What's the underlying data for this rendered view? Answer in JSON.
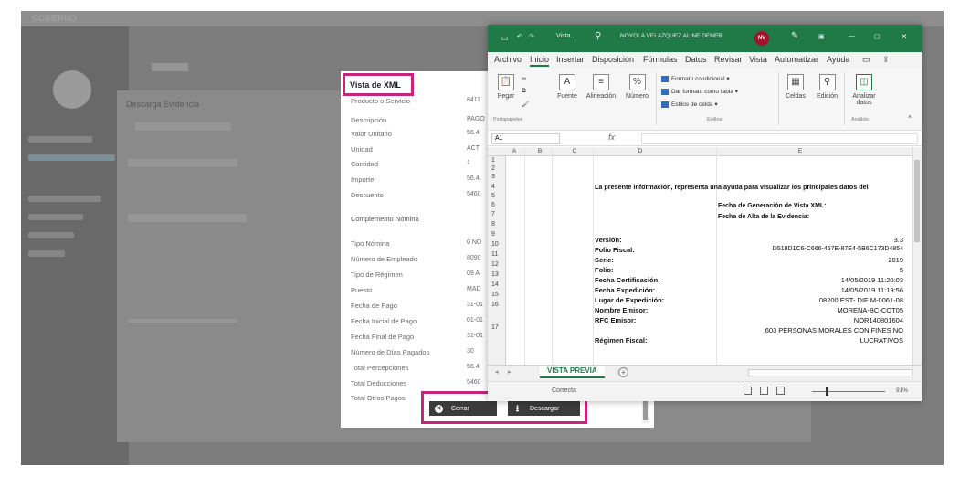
{
  "background": {
    "topbar_left": "GOBIERNO",
    "card_title": "Descarga Evidencia"
  },
  "xml_view": {
    "title": "Vista de XML",
    "rows": [
      {
        "label": "Producto o Servicio",
        "value": "8411"
      },
      {
        "label": "Descripción",
        "value": "PAGO"
      },
      {
        "label": "Valor Unitario",
        "value": "56.4"
      },
      {
        "label": "Unidad",
        "value": "ACT"
      },
      {
        "label": "Cantidad",
        "value": "1"
      },
      {
        "label": "Importe",
        "value": "56.4"
      },
      {
        "label": "Descuento",
        "value": "5460"
      }
    ],
    "section": "Complemento Nómina",
    "rows2": [
      {
        "label": "Tipo Nómina",
        "value": "0 NO"
      },
      {
        "label": "Número de Empleado",
        "value": "8090"
      },
      {
        "label": "Tipo de Régimen",
        "value": "09 A"
      },
      {
        "label": "Puesto",
        "value": "MAD"
      },
      {
        "label": "Fecha de Pago",
        "value": "31-01"
      },
      {
        "label": "Fecha Inicial de Pago",
        "value": "01-01"
      },
      {
        "label": "Fecha Final de Pago",
        "value": "31-01"
      },
      {
        "label": "Número de Días Pagados",
        "value": "30"
      },
      {
        "label": "Total Percepciones",
        "value": "56.4"
      },
      {
        "label": "Total Deducciones",
        "value": "5460"
      },
      {
        "label": "Total Otros Pagos",
        "value": "5460"
      }
    ],
    "close_label": "Cerrar",
    "download_label": "Descargar"
  },
  "excel": {
    "title_file": "Vista...",
    "title_user": "NOYOLA VELAZQUEZ ALINE DENEB",
    "avatar": "NV",
    "menu": [
      "Archivo",
      "Inicio",
      "Insertar",
      "Disposición",
      "Fórmulas",
      "Datos",
      "Revisar",
      "Vista",
      "Automatizar",
      "Ayuda"
    ],
    "ribbon": {
      "paste": "Pegar",
      "font": "Fuente",
      "alignment": "Alineación",
      "number": "Número",
      "cond_format": "Formato condicional",
      "table_format": "Dar formato como tabla",
      "cell_styles": "Estilos de celda",
      "cells": "Celdas",
      "editing": "Edición",
      "analyze": "Analizar datos",
      "group_clipboard": "Portapapeles",
      "group_styles": "Estilos",
      "group_analysis": "Análisis"
    },
    "name_box": "A1",
    "columns": [
      "A",
      "B",
      "C",
      "D",
      "E"
    ],
    "rows": [
      "1",
      "2",
      "3",
      "4",
      "5",
      "6",
      "7",
      "8",
      "9",
      "10",
      "11",
      "12",
      "13",
      "14",
      "15",
      "16",
      "17"
    ],
    "cells": {
      "intro": "La presente información, representa una ayuda para visualizar los principales datos del",
      "gen_date": "Fecha de Generación de Vista XML:",
      "evidence_date": "Fecha de Alta de la Evidencia:",
      "version_l": "Versión:",
      "version_v": "3.3",
      "folio_fiscal_l": "Folio Fiscal:",
      "folio_fiscal_v": "D518D1C6-C666-457E-87E4-5B6C173D4854",
      "serie_l": "Serie:",
      "serie_v": "2019",
      "folio_l": "Folio:",
      "folio_v": "5",
      "cert_l": "Fecha Certificación:",
      "cert_v": "14/05/2019 11:20:03",
      "exp_l": "Fecha Expedición:",
      "exp_v": "14/05/2019 11:19:56",
      "lugar_l": "Lugar de Expedición:",
      "lugar_v": "08200 EST- DIF M-0061-08",
      "emisor_l": "Nombre Emisor:",
      "emisor_v": "MORENA-BC-COT05",
      "rfc_l": "RFC Emisor:",
      "rfc_v": "NOR140801604",
      "regimen_v1": "603 PERSONAS MORALES CON FINES NO",
      "regimen_l": "Régimen Fiscal:",
      "regimen_v2": "LUCRATIVOS"
    },
    "sheet_tab": "VISTA PREVIA",
    "status": "Correcta",
    "zoom": "91%"
  }
}
